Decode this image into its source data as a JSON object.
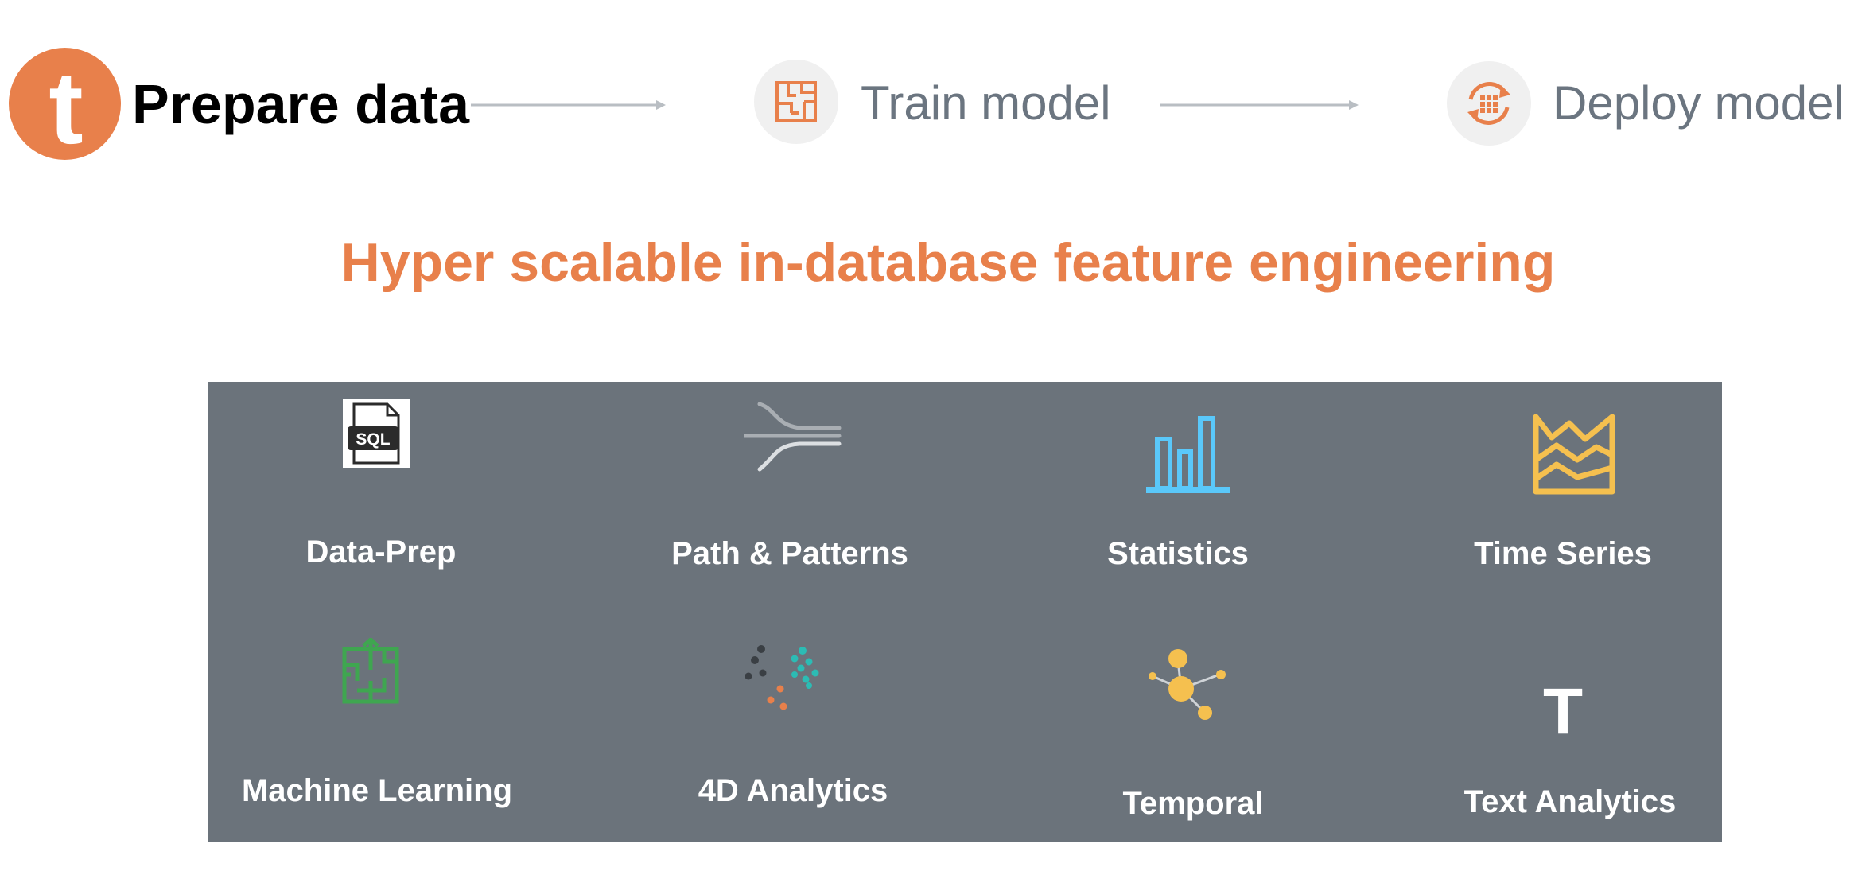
{
  "workflow": {
    "steps": [
      {
        "label": "Prepare data",
        "active": true,
        "icon": "teradata-logo-icon"
      },
      {
        "label": "Train model",
        "active": false,
        "icon": "maze-icon"
      },
      {
        "label": "Deploy model",
        "active": false,
        "icon": "deploy-cycle-icon"
      }
    ],
    "logo_letter": "t"
  },
  "headline": "Hyper scalable in-database feature engineering",
  "features": [
    {
      "label": "Data-Prep",
      "icon": "sql-file-icon",
      "icon_text": "SQL"
    },
    {
      "label": "Path & Patterns",
      "icon": "path-merge-icon"
    },
    {
      "label": "Statistics",
      "icon": "bar-chart-icon"
    },
    {
      "label": "Time Series",
      "icon": "area-chart-icon"
    },
    {
      "label": "Machine Learning",
      "icon": "maze-arrow-icon"
    },
    {
      "label": "4D Analytics",
      "icon": "dot-clusters-icon"
    },
    {
      "label": "Temporal",
      "icon": "network-nodes-icon"
    },
    {
      "label": "Text Analytics",
      "icon": "text-t-icon",
      "icon_text": "T"
    }
  ],
  "colors": {
    "brand_orange": "#e8804b",
    "panel_gray": "#6b737b",
    "inactive_text": "#6b7580",
    "stats_blue": "#5ac8fa",
    "timeseries_yellow": "#f5c04f",
    "ml_green": "#3fa650",
    "teal": "#2cbcb4",
    "dark_dot": "#3a3f44"
  }
}
